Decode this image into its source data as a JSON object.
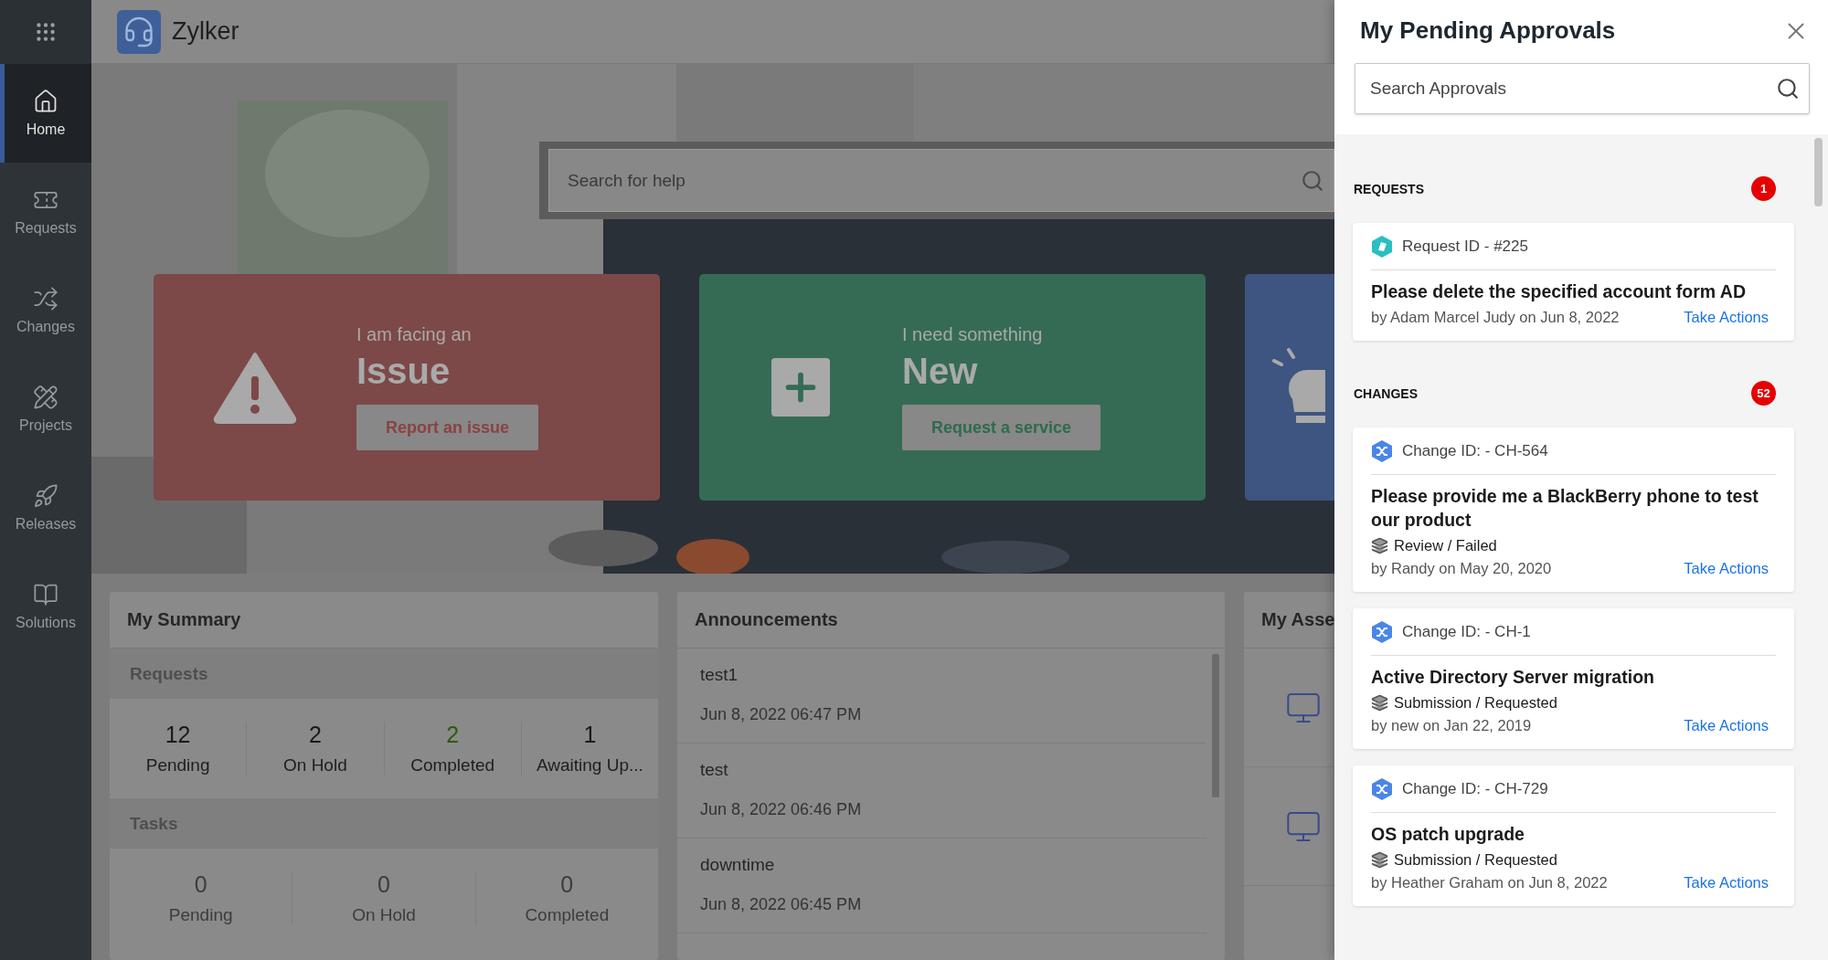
{
  "app": {
    "name": "Zylker"
  },
  "sidebar": [
    {
      "label": "Home",
      "selected": true
    },
    {
      "label": "Requests",
      "selected": false
    },
    {
      "label": "Changes",
      "selected": false
    },
    {
      "label": "Projects",
      "selected": false
    },
    {
      "label": "Releases",
      "selected": false
    },
    {
      "label": "Solutions",
      "selected": false
    }
  ],
  "hero": {
    "search_placeholder": "Search for help",
    "cards": [
      {
        "kind": "issue",
        "lead": "I am facing an",
        "title": "Issue",
        "button": "Report an issue"
      },
      {
        "kind": "new",
        "lead": "I need something",
        "title": "New",
        "button": "Request a service"
      },
      {
        "kind": "idea"
      }
    ]
  },
  "summary": {
    "title": "My Summary",
    "requests": {
      "heading": "Requests",
      "stats": [
        {
          "value": "12",
          "label": "Pending",
          "color": "#1a1a1a",
          "muted": false
        },
        {
          "value": "2",
          "label": "On Hold",
          "color": "#1a1a1a",
          "muted": false
        },
        {
          "value": "2",
          "label": "Completed",
          "color": "#2f5a08",
          "muted": false
        },
        {
          "value": "1",
          "label": "Awaiting Up...",
          "color": "#1a1a1a",
          "muted": false
        }
      ]
    },
    "tasks": {
      "heading": "Tasks",
      "stats": [
        {
          "value": "0",
          "label": "Pending",
          "muted": true
        },
        {
          "value": "0",
          "label": "On Hold",
          "muted": true
        },
        {
          "value": "0",
          "label": "Completed",
          "muted": true
        }
      ]
    }
  },
  "announcements": {
    "title": "Announcements",
    "items": [
      {
        "title": "test1",
        "time": "Jun 8, 2022 06:47 PM"
      },
      {
        "title": "test",
        "time": "Jun 8, 2022 06:46 PM"
      },
      {
        "title": "downtime",
        "time": "Jun 8, 2022 06:45 PM"
      }
    ]
  },
  "assets": {
    "title": "My Asse"
  },
  "approvals": {
    "title": "My Pending Approvals",
    "search_placeholder": "Search Approvals",
    "sections": [
      {
        "heading": "REQUESTS",
        "count": "1",
        "items": [
          {
            "kind": "request",
            "id": "Request ID - #225",
            "title": "Please delete the specified account form AD",
            "byline": "by Adam Marcel Judy on Jun 8, 2022",
            "action": "Take Actions"
          }
        ]
      },
      {
        "heading": "CHANGES",
        "count": "52",
        "items": [
          {
            "kind": "change",
            "id": "Change ID: - CH-564",
            "title": "Please provide me a BlackBerry phone to test our product",
            "status": "Review / Failed",
            "byline": "by Randy on May 20, 2020",
            "action": "Take Actions"
          },
          {
            "kind": "change",
            "id": "Change ID: - CH-1",
            "title": "Active Directory Server migration",
            "status": "Submission / Requested",
            "byline": "by new on Jan 22, 2019",
            "action": "Take Actions"
          },
          {
            "kind": "change",
            "id": "Change ID: - CH-729",
            "title": "OS patch upgrade",
            "status": "Submission / Requested",
            "byline": "by Heather Graham on Jun 8, 2022",
            "action": "Take Actions"
          }
        ]
      }
    ]
  }
}
